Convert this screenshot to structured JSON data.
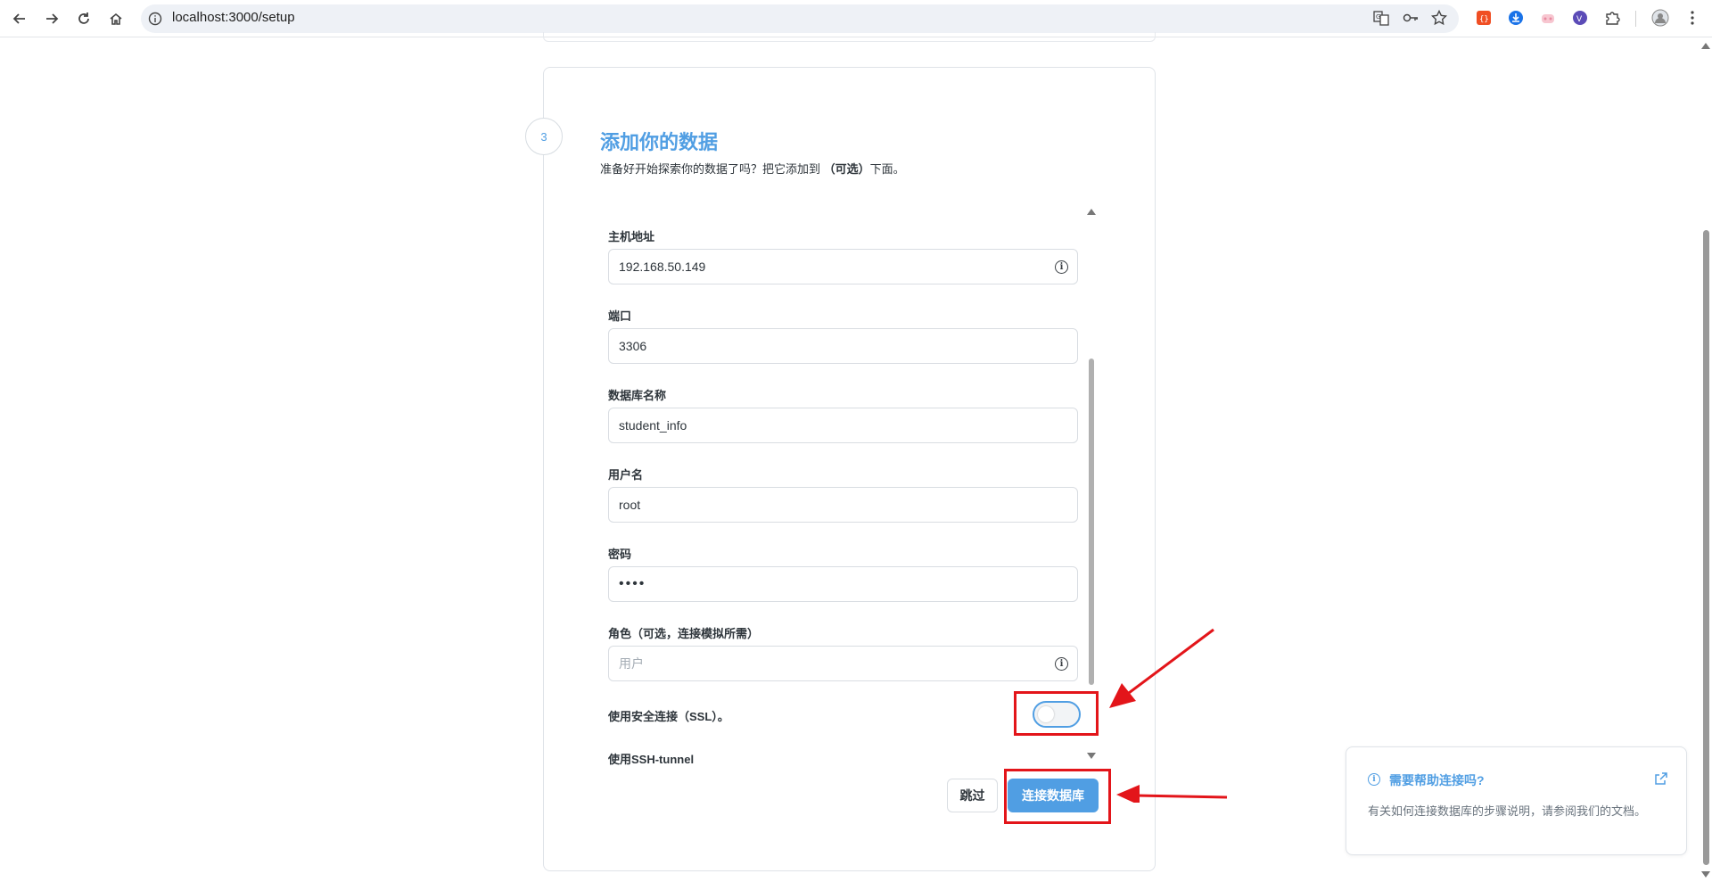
{
  "browser": {
    "url": "localhost:3000/setup"
  },
  "step": {
    "number": "3",
    "title": "添加你的数据",
    "subtitle_pre": "准备好开始探索你的数据了吗？把它添加到",
    "subtitle_bold": "（可选）",
    "subtitle_post": "下面。"
  },
  "form": {
    "host": {
      "label": "主机地址",
      "value": "192.168.50.149"
    },
    "port": {
      "label": "端口",
      "value": "3306"
    },
    "dbname": {
      "label": "数据库名称",
      "value": "student_info"
    },
    "username": {
      "label": "用户名",
      "value": "root"
    },
    "password": {
      "label": "密码",
      "value": "••••"
    },
    "role": {
      "label": "角色（可选，连接模拟所需）",
      "placeholder": "用户"
    },
    "ssl": {
      "label": "使用安全连接（SSL）。",
      "enabled": false
    },
    "ssh": {
      "label": "使用SSH-tunnel"
    }
  },
  "buttons": {
    "skip": "跳过",
    "connect": "连接数据库"
  },
  "help": {
    "title": "需要帮助连接吗?",
    "text": "有关如何连接数据库的步骤说明，请参阅我们的文档。"
  },
  "colors": {
    "brand": "#509ee3",
    "annotation": "#e3151a"
  }
}
